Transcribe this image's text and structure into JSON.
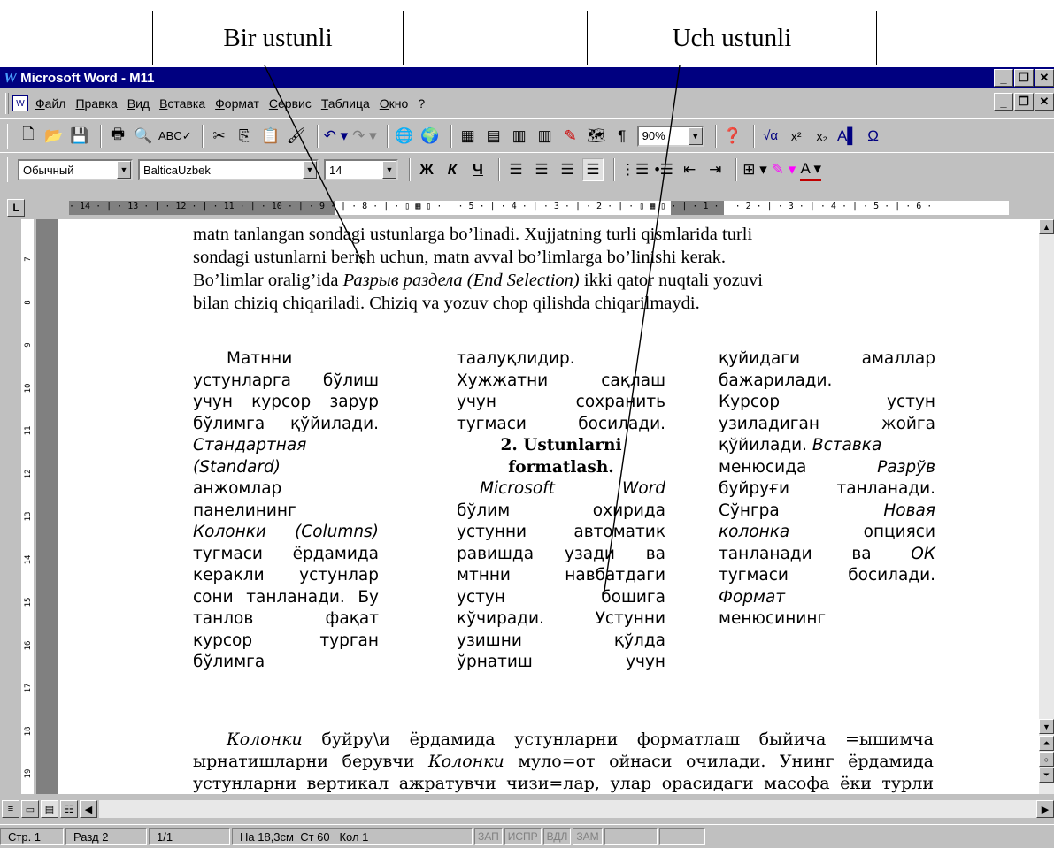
{
  "callouts": {
    "left": "Bir ustunli",
    "right": "Uch ustunli"
  },
  "window": {
    "title": "Microsoft Word - M11",
    "logo": "W"
  },
  "menu": [
    "Файл",
    "Правка",
    "Вид",
    "Вставка",
    "Формат",
    "Сервис",
    "Таблица",
    "Окно",
    "?"
  ],
  "toolbar": {
    "zoom": "90%"
  },
  "formatting": {
    "style": "Обычный",
    "font": "BalticaUzbek",
    "size": "14",
    "bold": "Ж",
    "italic": "К",
    "underline": "Ч"
  },
  "ruler_text": "· 14 · | · 13 · | · 12 · | · 11 · | · 10 · | · 9 · | · 8 · | · ▯ ▦ ▯ · | · 5 · | · 4 · | · 3 · | · 2 · | · ▯ ▦ ▯ · | · 1 · | · 2 · | · 3 · | · 4 · | · 5 · | · 6 ·",
  "document": {
    "para1": [
      "matn tanlangan sondagi ustunlarga bo’linadi. Xujjatning turli qismlarida turli",
      "sondagi ustunlarni berish uchun, matn avval bo’limlarga bo’linishi kerak.",
      "Bo’limlar oralig’ida ",
      "Разрыв раздела (End Selection)",
      " ikki qator nuqtali yozuvi",
      "bilan chiziq chiqariladi. Chiziq va yozuv chop qilishda chiqarilmaydi."
    ],
    "col1": [
      "Матнни",
      "устунларга бўлиш",
      "учун курсор зарур",
      "бўлимга қўйилади.",
      "Стандартная",
      "(Standard)",
      "анжомлар",
      "панелининг",
      "Колонки (Columns)",
      "тугмаси ёрдамида",
      "керакли устунлар",
      "сони танланади. Бу",
      "танлов фақат",
      "курсор турган",
      "бўлимга"
    ],
    "col2": [
      "таалуқлидир.",
      "Хужжатни сақлаш",
      "учун сохранить",
      "тугмаси босилади.",
      "2. Ustunlarni",
      "formatlash.",
      "Microsoft Word",
      "бўлим охирида",
      "устунни автоматик",
      "равишда узади ва",
      "мтнни навбатдаги",
      "устун бошига",
      "кўчиради. Устунни",
      "узишни қўлда",
      "ўрнатиш учун"
    ],
    "col3": [
      "қуйидаги амаллар",
      "бажарилади.",
      "Курсор устун",
      "узиладиган жойга",
      "қўйилади. ",
      "Вставка",
      "менюсида ",
      "Разрўв",
      "буйруғи танланади.",
      "Сўнгра ",
      "Новая",
      "колонка",
      " опцияси",
      "танланади ва ",
      "ОК",
      "тугмаси босилади.",
      "Формат",
      "менюсининг"
    ],
    "para2": [
      "Колонки",
      " буйру\\и ёрдамида устунларни форматлаш быйича =ышимча",
      "ырнатишларни берувчи ",
      "Колонки",
      " муло=от ойнаси очилади. Унинг ёрдамида",
      "устунларни вертикал ажратувчи чизи=лар, улар орасидаги масофа ёки турли"
    ]
  },
  "vruler_numbers": [
    "7",
    "8",
    "9",
    "10",
    "11",
    "12",
    "13",
    "14",
    "15",
    "16",
    "17",
    "18",
    "19"
  ],
  "status": {
    "page": "Стр. 1",
    "section": "Разд 2",
    "pages": "1/1",
    "position": "На 18,3см  Ст 60   Кол 1",
    "rec": "ЗАП",
    "trk": "ИСПР",
    "ext": "ВДЛ",
    "ovr": "ЗАМ"
  }
}
